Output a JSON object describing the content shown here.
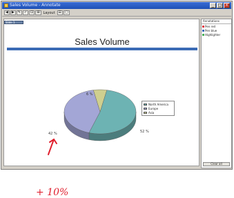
{
  "window": {
    "title": "Sales Volume - Annotate",
    "minimize": "_",
    "maximize": "□",
    "close": "×"
  },
  "toolbar": {
    "items": [
      "◀",
      "▶",
      "✎",
      "✓",
      "⊡",
      "⊞"
    ],
    "label": "Layout",
    "extra": [
      "☰",
      "▢"
    ]
  },
  "slide": {
    "corner_tag": "Slide 1",
    "title": "Sales Volume",
    "labels": {
      "europe": "42 %",
      "north_america": "52 %",
      "asia": "6 %"
    },
    "annotation": "+ 10%"
  },
  "chart_data": {
    "type": "pie",
    "categories": [
      "North America",
      "Europe",
      "Asia"
    ],
    "values": [
      52,
      42,
      6
    ],
    "colors": [
      "#6db3b3",
      "#a3a6d6",
      "#cfcf8f"
    ],
    "legend_placement": "right"
  },
  "side_pane": {
    "header": "Annotations",
    "items": [
      {
        "label": "Pen red",
        "color": "#e01f2d"
      },
      {
        "label": "Pen blue",
        "color": "#2f5fb5"
      },
      {
        "label": "Highlighter",
        "color": "#39a94a"
      }
    ],
    "footer": "Clear all"
  }
}
